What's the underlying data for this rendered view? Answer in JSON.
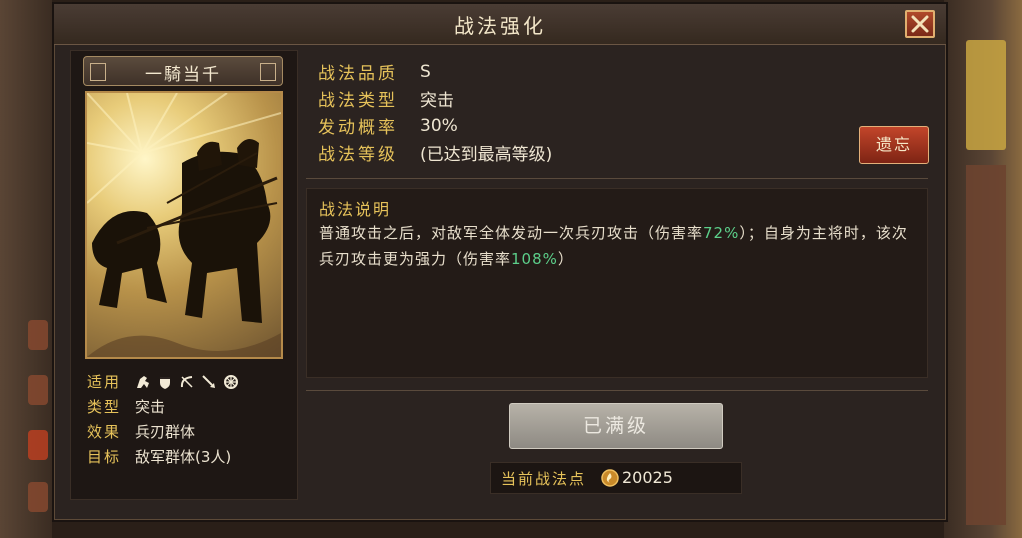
{
  "dialog": {
    "title": "战法强化"
  },
  "skill": {
    "name": "一騎当千",
    "attributes": [
      {
        "key": "适用",
        "value": ""
      },
      {
        "key": "类型",
        "value": "突击"
      },
      {
        "key": "效果",
        "value": "兵刃群体"
      },
      {
        "key": "目标",
        "value": "敌军群体(3人)"
      }
    ],
    "applicable_icons": [
      "cavalry-icon",
      "shield-icon",
      "bow-icon",
      "spear-icon",
      "chariot-icon"
    ]
  },
  "properties": [
    {
      "key": "战法品质",
      "value": "S"
    },
    {
      "key": "战法类型",
      "value": "突击"
    },
    {
      "key": "发动概率",
      "value": "30%"
    },
    {
      "key": "战法等级",
      "value": "(已达到最高等级)"
    }
  ],
  "forget_button": "遗忘",
  "description": {
    "title": "战法说明",
    "part1": "普通攻击之后，对敌军全体发动一次兵刃攻击（伤害率",
    "value1": "72%",
    "part2": "）；自身为主将时，该次兵刃攻击更为强力（伤害率",
    "value2": "108%",
    "part3": "）"
  },
  "max_level_button": "已满级",
  "points": {
    "label": "当前战法点",
    "value": "20025"
  },
  "colors": {
    "accent_gold": "#e6c25a",
    "highlight_green": "#5ccf8a",
    "button_red": "#c2452a"
  }
}
